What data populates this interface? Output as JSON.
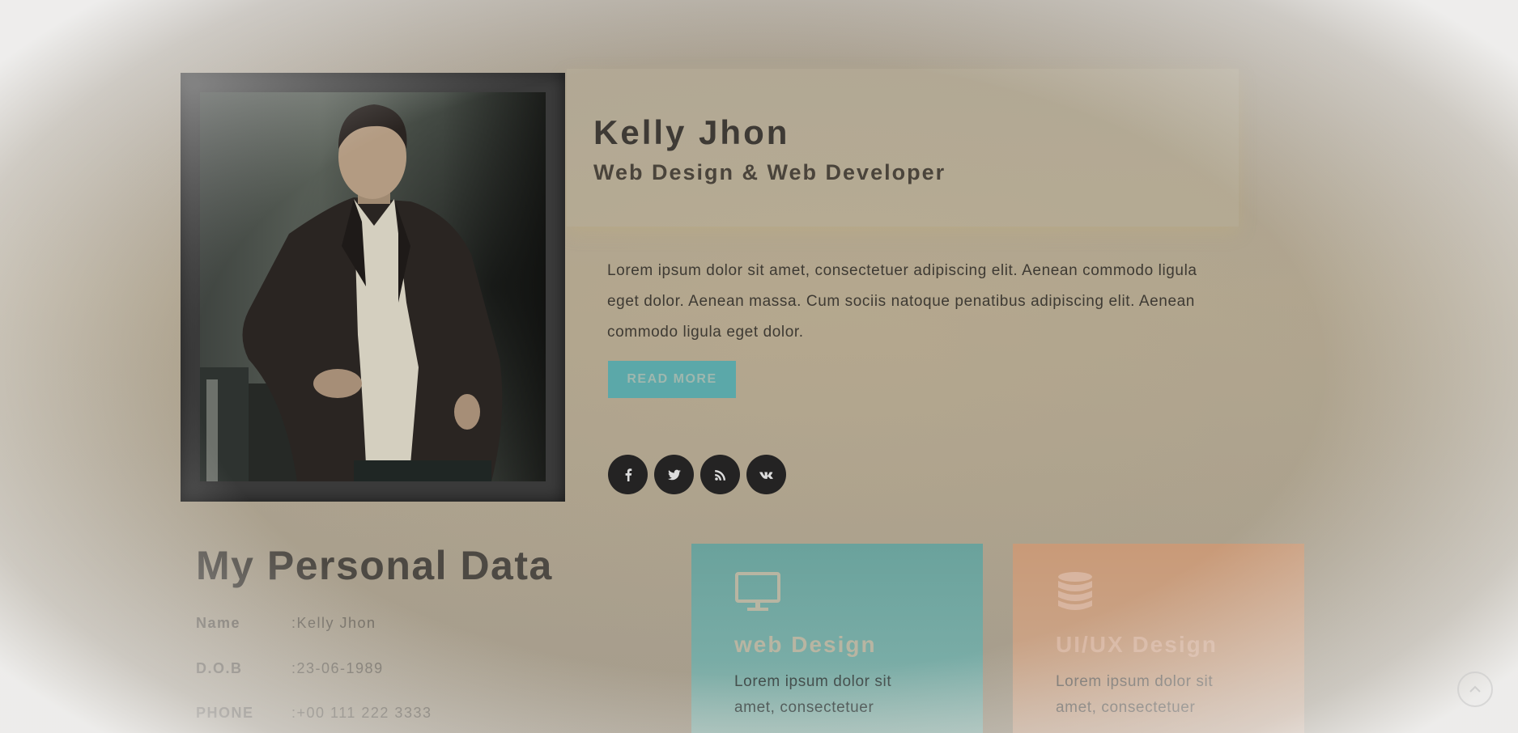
{
  "profile": {
    "name": "Kelly Jhon",
    "role": "Web Design & Web Developer",
    "bio": "Lorem ipsum dolor sit amet, consectetuer adipiscing elit. Aenean commodo ligula eget dolor. Aenean massa. Cum sociis natoque penatibus adipiscing elit. Aenean commodo ligula eget dolor.",
    "read_more_label": "READ MORE",
    "photo_icon": "portrait-photo"
  },
  "social": [
    {
      "icon": "facebook-icon"
    },
    {
      "icon": "twitter-icon"
    },
    {
      "icon": "rss-icon"
    },
    {
      "icon": "vk-icon"
    }
  ],
  "personal_data": {
    "title": "My Personal Data",
    "rows": [
      {
        "label": "Name",
        "value": ":Kelly Jhon"
      },
      {
        "label": "D.O.B",
        "value": ":23-06-1989"
      },
      {
        "label": "PHONE",
        "value": ":+00 111 222 3333"
      }
    ]
  },
  "services": [
    {
      "icon": "monitor-icon",
      "title": "web Design",
      "text": "Lorem ipsum dolor sit amet, consectetuer",
      "color": "#6aa29c"
    },
    {
      "icon": "database-icon",
      "title": "UI/UX Design",
      "text": "Lorem ipsum dolor sit amet, consectetuer",
      "color": "#c99a78"
    }
  ],
  "colors": {
    "accent": "#5ba8a9",
    "social_bg": "#242323"
  }
}
